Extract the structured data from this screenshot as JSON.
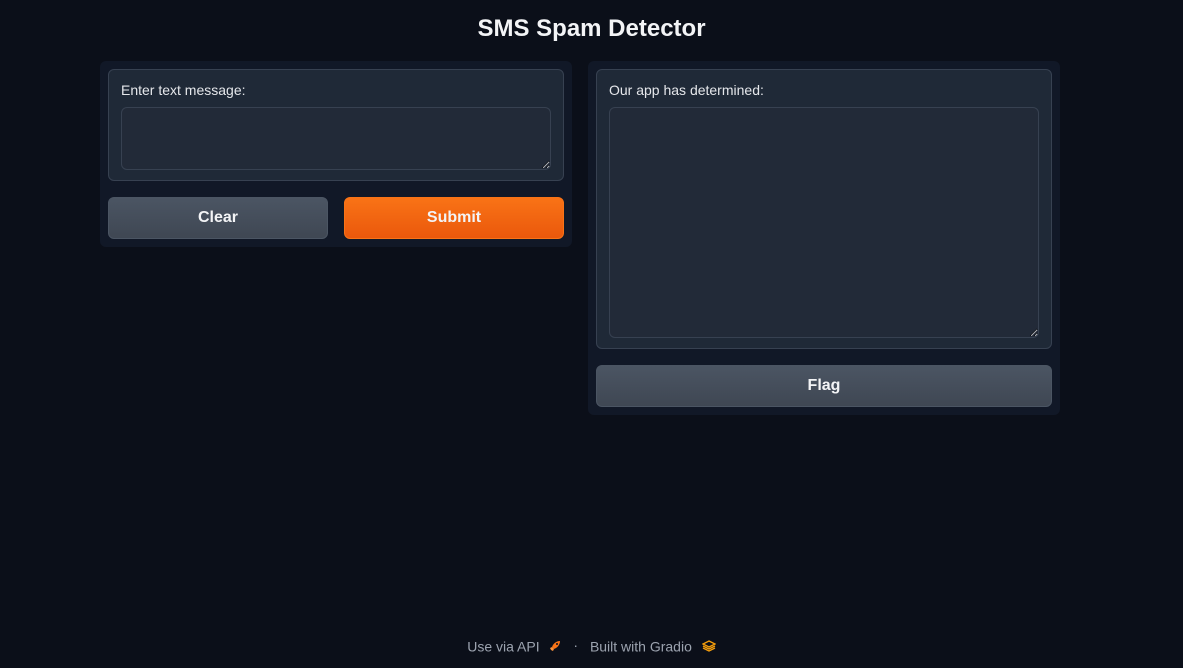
{
  "app": {
    "title": "SMS Spam Detector"
  },
  "input": {
    "label": "Enter text message:",
    "value": ""
  },
  "output": {
    "label": "Our app has determined:",
    "value": ""
  },
  "buttons": {
    "clear": "Clear",
    "submit": "Submit",
    "flag": "Flag"
  },
  "footer": {
    "api_link": "Use via API",
    "separator": "·",
    "built_with": "Built with Gradio",
    "api_icon": "rocket-icon",
    "gradio_icon": "gradio-logo-icon"
  },
  "colors": {
    "background": "#0b0f19",
    "panel": "#1f2937",
    "primary": "#f97316",
    "secondary": "#4b5563"
  }
}
